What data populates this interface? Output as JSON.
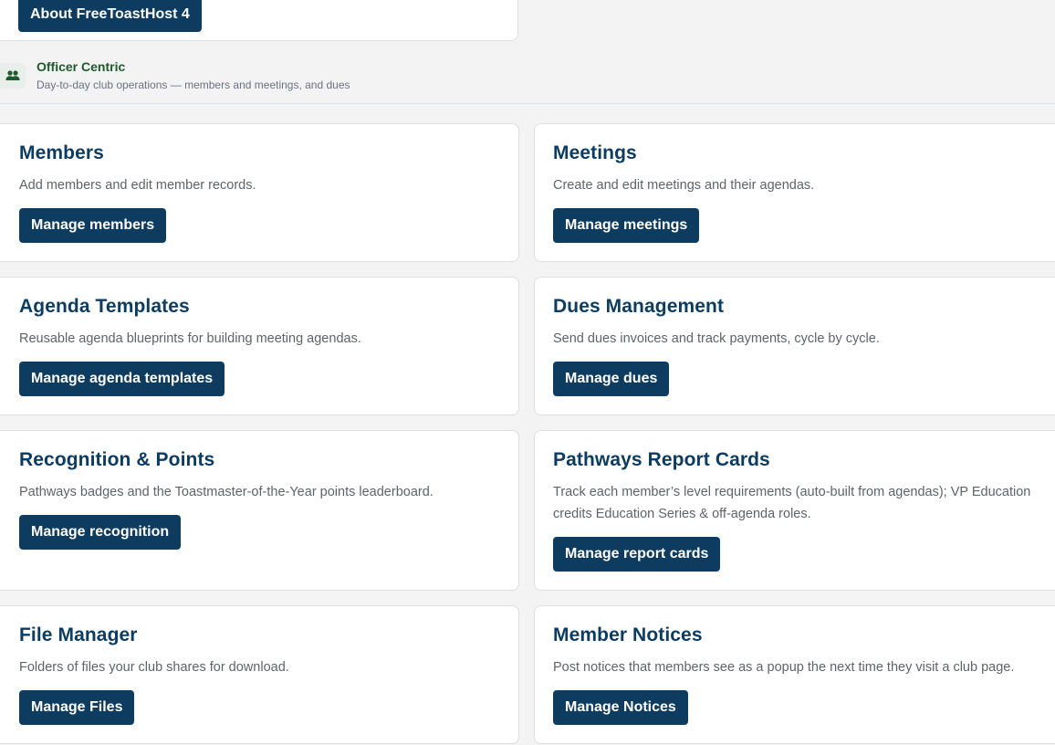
{
  "about": {
    "button_label": "About FreeToastHost 4"
  },
  "section": {
    "icon": "people-icon",
    "title": "Officer Centric",
    "subtitle": "Day-to-day club operations — members and meetings, and dues",
    "accent_color": "#1d5a2c"
  },
  "cards": {
    "members": {
      "title": "Members",
      "description": "Add members and edit member records.",
      "button_label": "Manage members"
    },
    "meetings": {
      "title": "Meetings",
      "description": "Create and edit meetings and their agendas.",
      "button_label": "Manage meetings"
    },
    "agenda_templates": {
      "title": "Agenda Templates",
      "description": "Reusable agenda blueprints for building meeting agendas.",
      "button_label": "Manage agenda templates"
    },
    "dues": {
      "title": "Dues Management",
      "description": "Send dues invoices and track payments, cycle by cycle.",
      "button_label": "Manage dues"
    },
    "recognition": {
      "title": "Recognition & Points",
      "description": "Pathways badges and the Toastmaster-of-the-Year points leaderboard.",
      "button_label": "Manage recognition"
    },
    "report_cards": {
      "title": "Pathways Report Cards",
      "description": "Track each member’s level requirements (auto-built from agendas); VP Education credits Education Series & off-agenda roles.",
      "button_label": "Manage report cards"
    },
    "files": {
      "title": "File Manager",
      "description": "Folders of files your club shares for download.",
      "button_label": "Manage Files"
    },
    "notices": {
      "title": "Member Notices",
      "description": "Post notices that members see as a popup the next time they visit a club page.",
      "button_label": "Manage Notices"
    }
  },
  "colors": {
    "primary": "#0e3c61",
    "background": "#f2f3f2",
    "card": "#ffffff"
  }
}
